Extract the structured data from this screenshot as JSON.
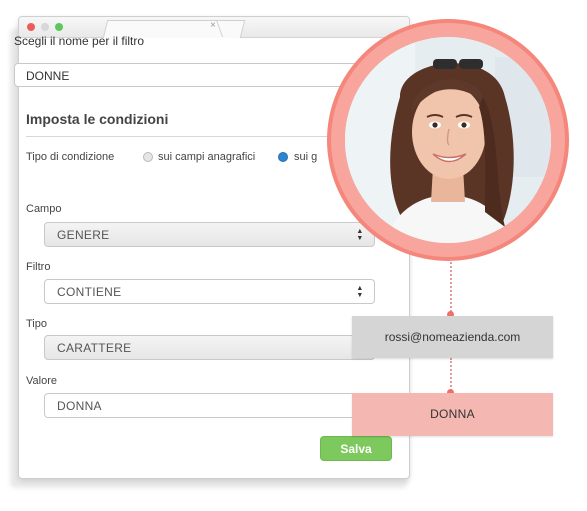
{
  "window": {
    "tab_close_glyph": "×"
  },
  "form": {
    "name_label": "Scegli il nome per il filtro",
    "name_value": "DONNE",
    "section_title": "Imposta le condizioni",
    "condition_type_label": "Tipo di condizione",
    "condition_options": [
      "sui campi anagrafici",
      "sui g"
    ],
    "condition_selected_index": 1,
    "field_label": "Campo",
    "field_value": "GENERE",
    "filter_label": "Filtro",
    "filter_value": "CONTIENE",
    "type_label": "Tipo",
    "type_value": "CARATTERE",
    "value_label": "Valore",
    "value_value": "DONNA",
    "save_label": "Salva"
  },
  "contact": {
    "email": "rossi@nomeazienda.com",
    "gender_value": "DONNA"
  },
  "colors": {
    "accent_green": "#7dc95d",
    "ring_coral": "#f4867b",
    "tag_pink": "#f5b7b1",
    "tag_gray": "#d5d5d5"
  }
}
